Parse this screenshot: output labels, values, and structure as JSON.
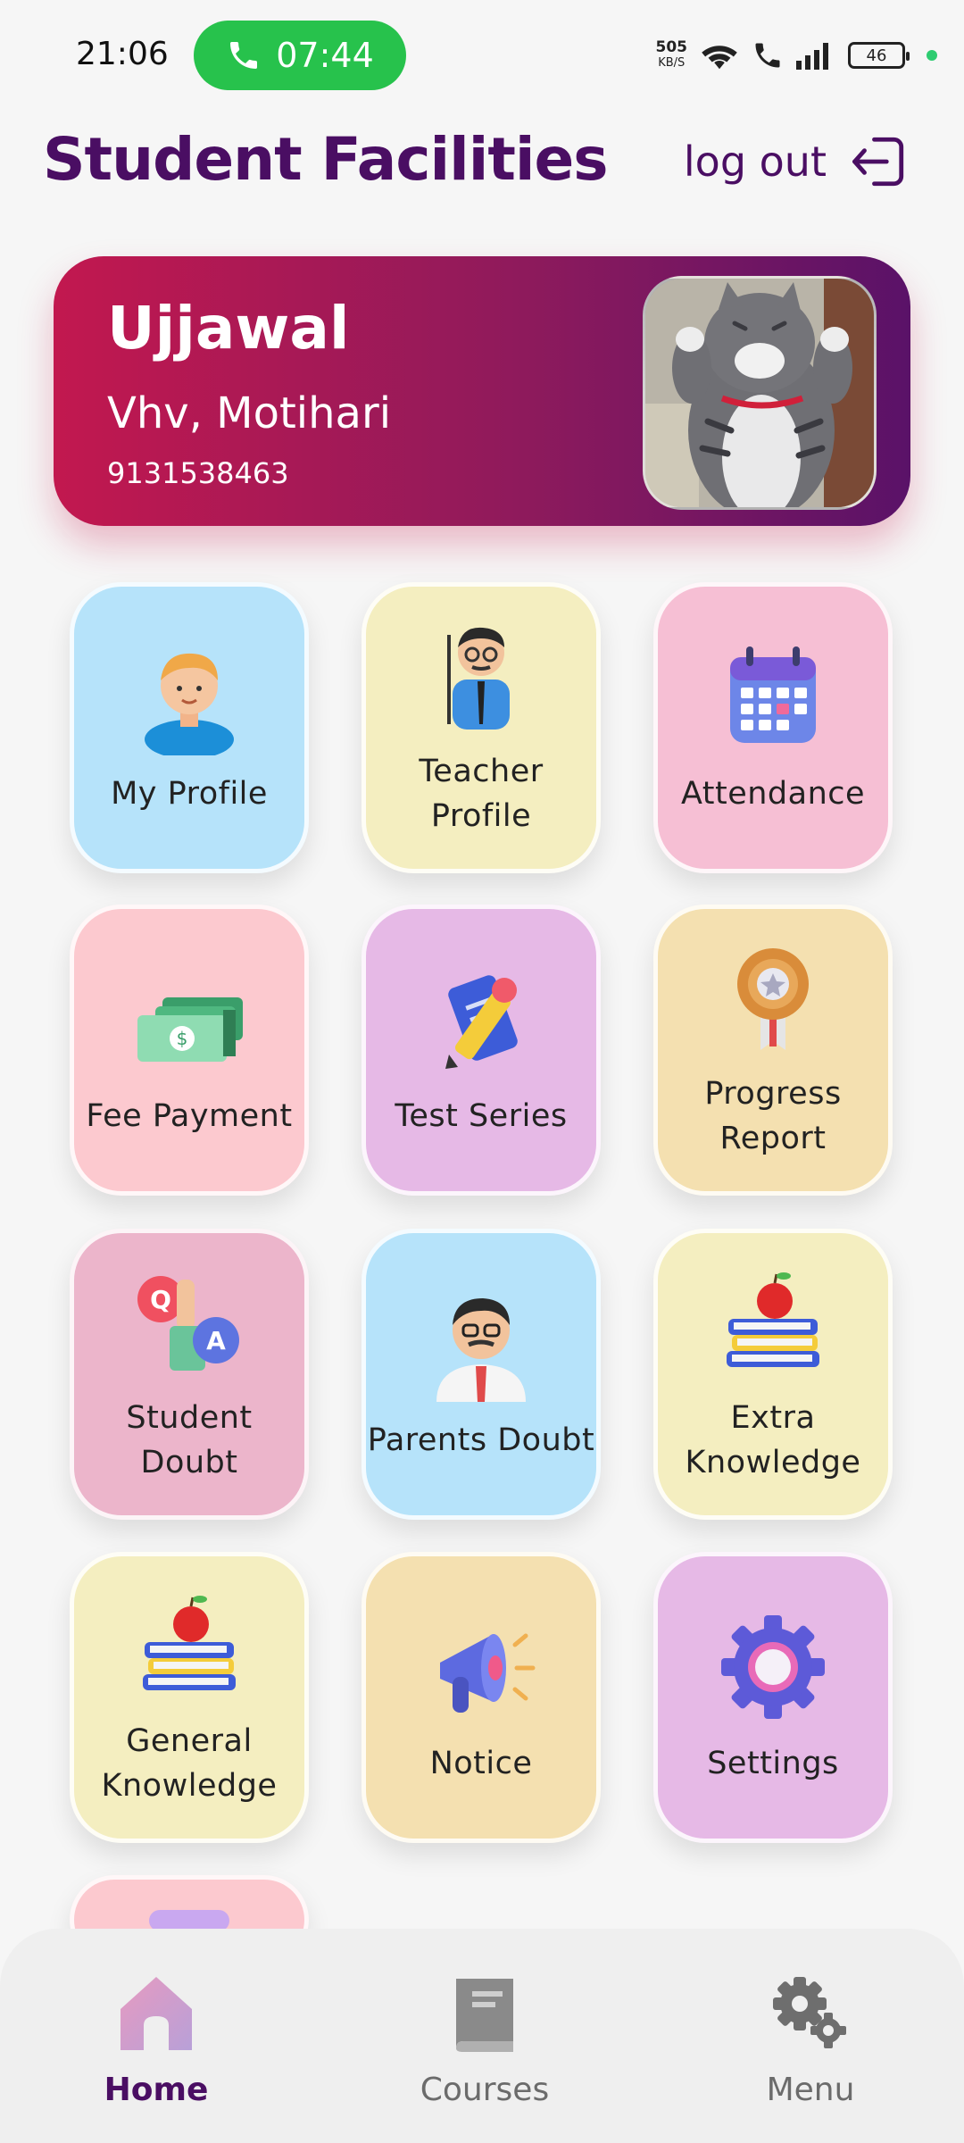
{
  "status_bar": {
    "time": "21:06",
    "call_timer": "07:44",
    "net_speed_value": "505",
    "net_speed_unit": "KB/S",
    "battery": "46"
  },
  "header": {
    "title": "Student Facilities",
    "logout_label": "log out"
  },
  "profile": {
    "name": "Ujjawal",
    "location": "Vhv, Motihari",
    "phone": "9131538463"
  },
  "tiles": [
    {
      "label": "My Profile"
    },
    {
      "label": "Teacher Profile"
    },
    {
      "label": "Attendance"
    },
    {
      "label": "Fee Payment"
    },
    {
      "label": "Test Series"
    },
    {
      "label": "Progress Report"
    },
    {
      "label": "Student Doubt"
    },
    {
      "label": "Parents Doubt"
    },
    {
      "label": "Extra Knowledge"
    },
    {
      "label": "General Knowledge"
    },
    {
      "label": "Notice"
    },
    {
      "label": "Settings"
    }
  ],
  "bottom_nav": {
    "home": "Home",
    "courses": "Courses",
    "menu": "Menu"
  },
  "colors": {
    "brand": "#4a0e63",
    "card_gradient_start": "#c2184f",
    "card_gradient_end": "#5a1268",
    "call_green": "#27c24c"
  }
}
